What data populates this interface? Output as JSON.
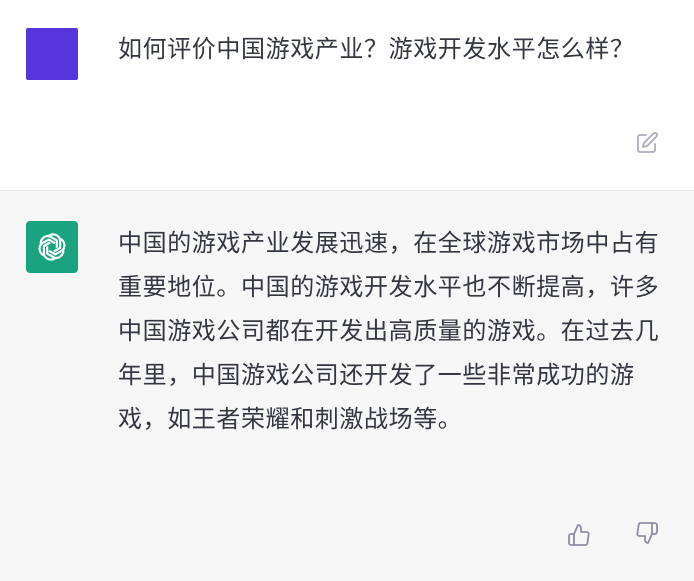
{
  "conversation": {
    "user_message": {
      "text": "如何评价中国游戏产业？游戏开发水平怎么样？",
      "avatar_color": "#5436da",
      "edit_icon": "edit-icon"
    },
    "assistant_message": {
      "text": "中国的游戏产业发展迅速，在全球游戏市场中占有重要地位。中国的游戏开发水平也不断提高，许多中国游戏公司都在开发出高质量的游戏。在过去几年里，中国游戏公司还开发了一些非常成功的游戏，如王者荣耀和刺激战场等。",
      "avatar_color": "#19a37f",
      "avatar_icon": "openai-logo-icon",
      "feedback_icons": [
        "thumbs-up-icon",
        "thumbs-down-icon"
      ]
    }
  }
}
